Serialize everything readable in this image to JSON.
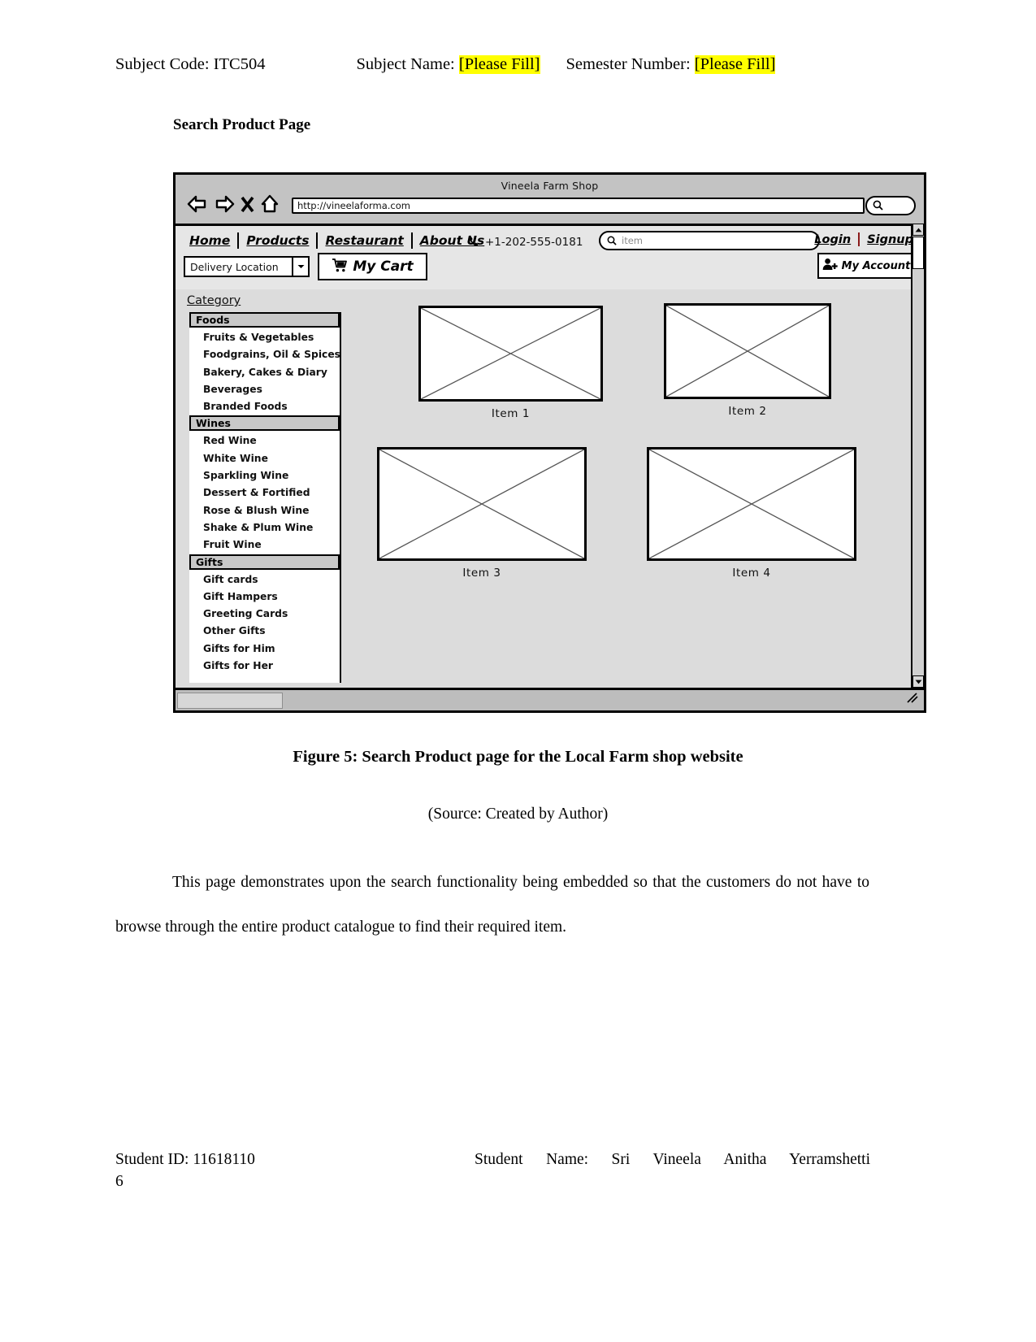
{
  "header": {
    "subject_code_label": "Subject Code: ITC504",
    "subject_name_label": "Subject Name:",
    "subject_name_value": "[Please Fill]",
    "semester_label": "Semester Number:",
    "semester_value": "[Please Fill]"
  },
  "page_title": "Search Product Page",
  "mockup": {
    "window_title": "Vineela Farm Shop",
    "url": "http://vineelaforma.com",
    "browser_icons": [
      "back-arrow-icon",
      "forward-arrow-icon",
      "close-x-icon",
      "home-icon",
      "search-icon"
    ],
    "nav": [
      {
        "label": "Home"
      },
      {
        "label": "Products"
      },
      {
        "label": "Restaurant"
      },
      {
        "label": "About Us"
      }
    ],
    "phone": "+1-202-555-0181",
    "search": {
      "placeholder": "item",
      "value": ""
    },
    "auth": {
      "login": "Login",
      "signup": "Signup",
      "separator_color": "#8b1a1a"
    },
    "delivery": {
      "label": "Delivery Location"
    },
    "cart": {
      "label": "My Cart"
    },
    "account": {
      "label": "My Account"
    },
    "category_heading": "Category",
    "categories": [
      {
        "group": "Foods",
        "items": [
          "Fruits & Vegetables",
          "Foodgrains, Oil & Spices",
          "Bakery, Cakes & Diary",
          "Beverages",
          "Branded Foods"
        ]
      },
      {
        "group": "Wines",
        "items": [
          "Red Wine",
          "White Wine",
          "Sparkling Wine",
          "Dessert & Fortified",
          "Rose & Blush Wine",
          "Shake & Plum Wine",
          "Fruit Wine"
        ]
      },
      {
        "group": "Gifts",
        "items": [
          "Gift cards",
          "Gift Hampers",
          "Greeting Cards",
          "Other Gifts",
          "Gifts for Him",
          "Gifts for Her"
        ]
      }
    ],
    "products": [
      {
        "caption": "Item 1"
      },
      {
        "caption": "Item 2"
      },
      {
        "caption": "Item 3"
      },
      {
        "caption": "Item 4"
      }
    ]
  },
  "figure_caption": "Figure 5: Search Product page for the Local Farm shop website",
  "figure_source": "(Source: Created by Author)",
  "body_paragraph": "This page demonstrates upon the search functionality being embedded so that the customers do not have to browse through the entire product catalogue to find their required item.",
  "footer": {
    "student_id": "Student ID: 11618110",
    "page_number": "6",
    "student_name": "Student Name: Sri Vineela Anitha Yerramshetti"
  }
}
